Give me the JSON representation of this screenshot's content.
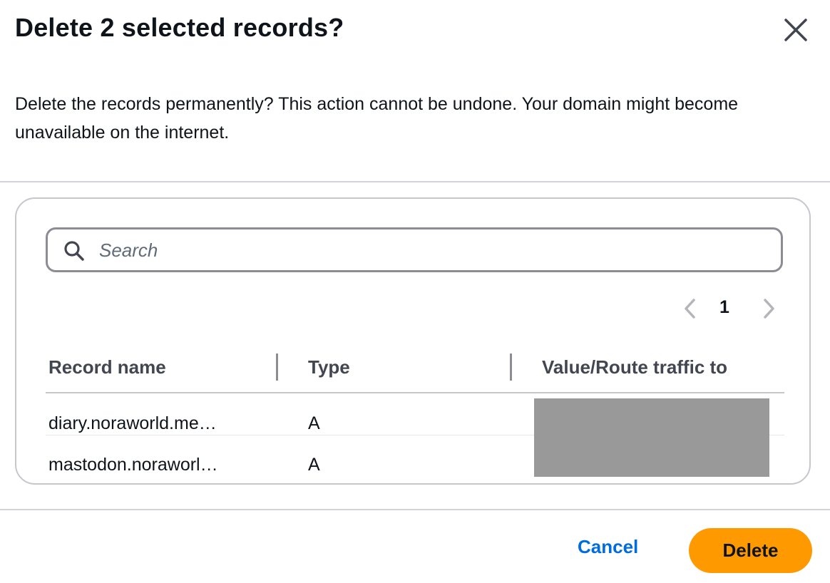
{
  "modal": {
    "title": "Delete 2 selected records?",
    "description": "Delete the records permanently? This action cannot be undone. Your domain might become unavailable on the internet."
  },
  "search": {
    "placeholder": "Search",
    "value": ""
  },
  "pagination": {
    "current_page": "1"
  },
  "table": {
    "headers": [
      "Record name",
      "Type",
      "Value/Route traffic to"
    ],
    "rows": [
      {
        "name": "diary.noraworld.me…",
        "type": "A"
      },
      {
        "name": "mastodon.noraworl…",
        "type": "A"
      }
    ]
  },
  "footer": {
    "cancel_label": "Cancel",
    "delete_label": "Delete"
  },
  "icons": {
    "close": "close-icon",
    "search": "search-icon",
    "prev": "chevron-left-icon",
    "next": "chevron-right-icon"
  },
  "colors": {
    "primary_button": "#ff9900",
    "link": "#006ce0"
  }
}
